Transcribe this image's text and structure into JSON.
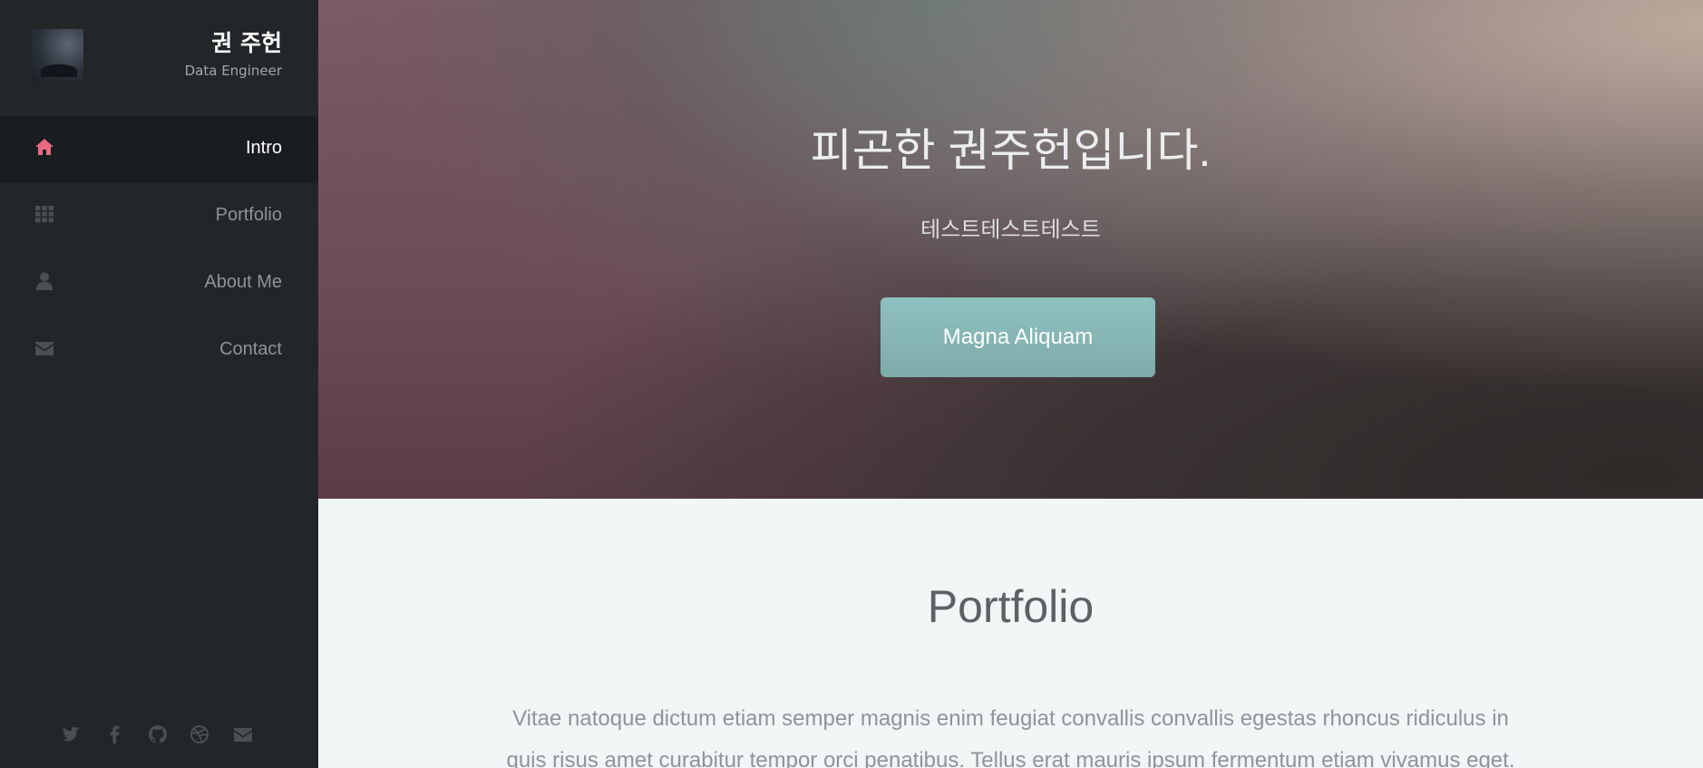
{
  "profile": {
    "name": "권 주헌",
    "role": "Data Engineer"
  },
  "nav": {
    "items": [
      {
        "label": "Intro",
        "icon": "home-icon",
        "active": true
      },
      {
        "label": "Portfolio",
        "icon": "grid-icon",
        "active": false
      },
      {
        "label": "About Me",
        "icon": "user-icon",
        "active": false
      },
      {
        "label": "Contact",
        "icon": "envelope-icon",
        "active": false
      }
    ]
  },
  "social": [
    "twitter-icon",
    "facebook-icon",
    "github-icon",
    "dribbble-icon",
    "envelope-icon"
  ],
  "hero": {
    "title": "피곤한 권주헌입니다.",
    "subtitle": "테스트테스트테스트",
    "button_label": "Magna Aliquam"
  },
  "portfolio": {
    "title": "Portfolio",
    "text": "Vitae natoque dictum etiam semper magnis enim feugiat convallis convallis egestas rhoncus ridiculus in quis risus amet curabitur tempor orci penatibus. Tellus erat mauris ipsum fermentum etiam vivamus eget."
  },
  "colors": {
    "sidebar_bg": "#222629",
    "active_icon": "#e76b82",
    "icon_muted": "#4a4f54",
    "button": "#86b6b5",
    "section_bg": "#f1f6f6"
  }
}
